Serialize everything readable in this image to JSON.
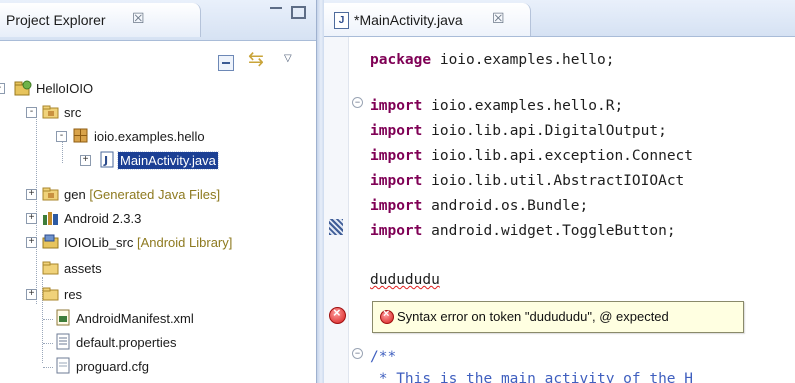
{
  "project_explorer": {
    "title": "Project Explorer",
    "close_glyph": "☒",
    "tree": [
      {
        "label": "HelloIOIO",
        "icon": "android-project-icon"
      },
      {
        "label": "src",
        "icon": "source-folder-icon"
      },
      {
        "label": "ioio.examples.hello",
        "icon": "package-icon"
      },
      {
        "label": "MainActivity.java",
        "icon": "java-file-icon",
        "selected": true
      },
      {
        "label": "gen",
        "decoration": "[Generated Java Files]",
        "icon": "source-folder-icon"
      },
      {
        "label": "Android 2.3.3",
        "icon": "library-icon"
      },
      {
        "label": "IOIOLib_src",
        "decoration": "[Android Library]",
        "icon": "linked-project-icon"
      },
      {
        "label": "assets",
        "icon": "folder-icon"
      },
      {
        "label": "res",
        "icon": "folder-icon"
      },
      {
        "label": "AndroidManifest.xml",
        "icon": "xml-file-icon"
      },
      {
        "label": "default.properties",
        "icon": "properties-file-icon"
      },
      {
        "label": "proguard.cfg",
        "icon": "text-file-icon"
      }
    ]
  },
  "editor": {
    "tab_title": "*MainActivity.java",
    "tab_icon": "J",
    "close_glyph": "☒",
    "code": {
      "package_kw": "package",
      "package_name": " ioio.examples.hello;",
      "import_kw": "import",
      "imports": [
        " ioio.examples.hello.R;",
        " ioio.lib.api.DigitalOutput;",
        " ioio.lib.api.exception.Connect",
        " ioio.lib.util.AbstractIOIOAct",
        " android.os.Bundle;",
        " android.widget.ToggleButton;"
      ],
      "error_token": "dudududu",
      "comment_start": "/**",
      "comment_line": " * This is the main activity of the H"
    },
    "hover": {
      "message": "Syntax error on token \"dudududu\", @ expected"
    }
  },
  "colors": {
    "keyword": "#7f0055",
    "comment": "#3f5fbf",
    "selection": "#1b3f94",
    "hover_bg": "#ffffe1",
    "error": "#d61d1d"
  }
}
